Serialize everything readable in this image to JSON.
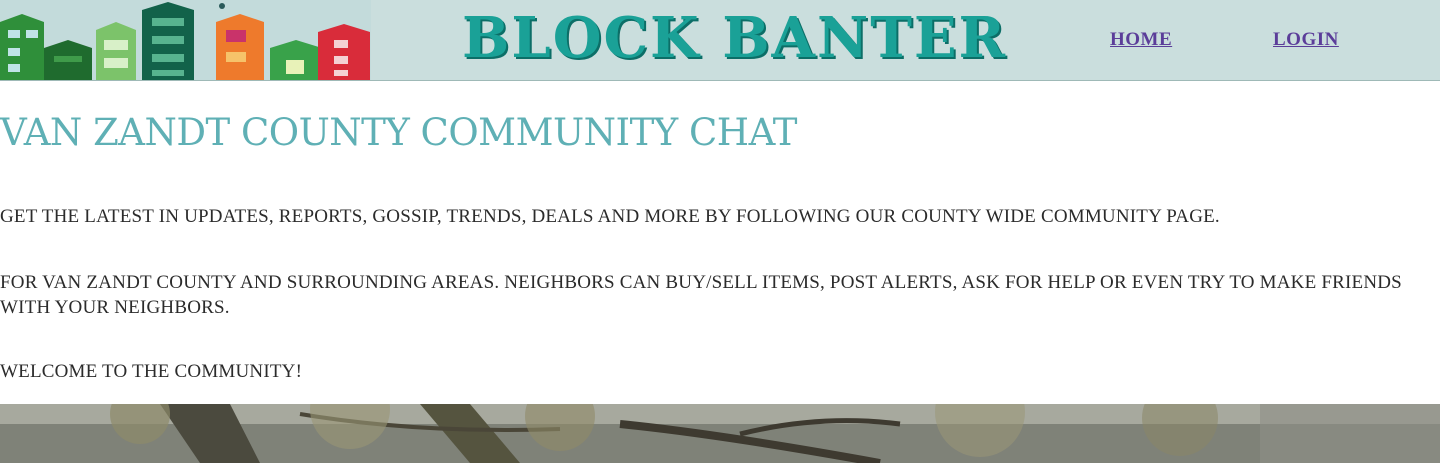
{
  "header": {
    "brand": "BLOCK BANTER",
    "nav": [
      {
        "label": "HOME"
      },
      {
        "label": "LOGIN"
      }
    ]
  },
  "main": {
    "title": "VAN ZANDT COUNTY COMMUNITY CHAT",
    "paragraphs": [
      "GET THE LATEST IN UPDATES, REPORTS, GOSSIP, TRENDS, DEALS AND MORE BY FOLLOWING OUR COUNTY WIDE COMMUNITY PAGE.",
      "FOR VAN ZANDT COUNTY AND SURROUNDING AREAS. NEIGHBORS CAN BUY/SELL ITEMS, POST ALERTS, ASK FOR HELP OR EVEN TRY TO MAKE FRIENDS WITH YOUR NEIGHBORS.",
      "WELCOME TO THE COMMUNITY!"
    ]
  },
  "colors": {
    "header_bg": "#cadedd",
    "brand": "#1aa197",
    "nav_link": "#5b3d99",
    "title": "#5fb0b5",
    "body_text": "#2b2b2b"
  }
}
